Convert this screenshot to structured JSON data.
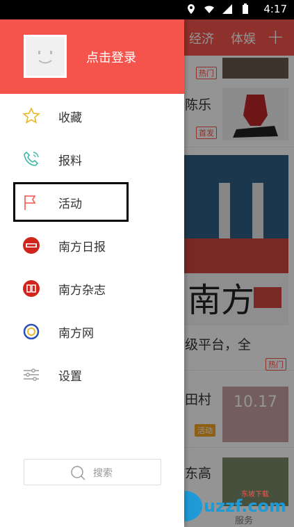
{
  "status_bar": {
    "time": "4:17"
  },
  "background": {
    "tabs": [
      "经济",
      "体娱"
    ],
    "plus": "+",
    "rows": [
      {
        "text": "陈乐",
        "tag": "首发"
      },
      {
        "text": "级平台，全",
        "tag": "热门"
      },
      {
        "text": "田村",
        "tag": "活动",
        "image_label": "10.17"
      },
      {
        "text": "东高",
        "tag": ""
      }
    ],
    "top_tag": "热门",
    "bottom_label": "服务",
    "watermark": "uzzf.com",
    "watermark_sub": "东坡下载"
  },
  "drawer": {
    "login_label": "点击登录",
    "menu": [
      {
        "label": "收藏",
        "icon": "star-icon"
      },
      {
        "label": "报料",
        "icon": "phone-icon"
      },
      {
        "label": "活动",
        "icon": "flag-icon"
      },
      {
        "label": "南方日报",
        "icon": "nanfang-daily-icon"
      },
      {
        "label": "南方杂志",
        "icon": "nanfang-magazine-icon"
      },
      {
        "label": "南方网",
        "icon": "nanfang-net-icon"
      },
      {
        "label": "设置",
        "icon": "settings-icon"
      }
    ],
    "search_placeholder": "搜索"
  },
  "colors": {
    "accent": "#f5544c",
    "menu_text": "#333333",
    "icon_gold": "#e8b923",
    "icon_teal": "#3fb8a8"
  }
}
